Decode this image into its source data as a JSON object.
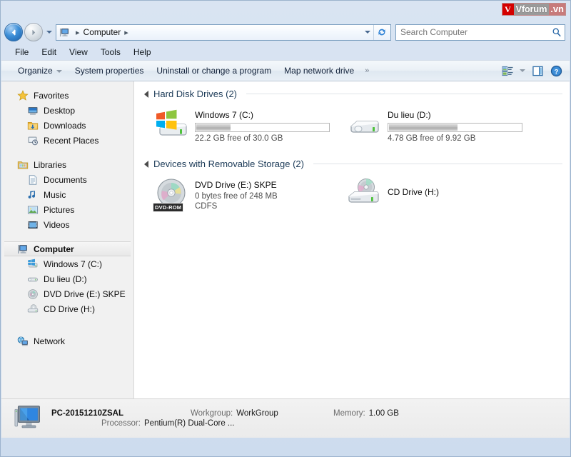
{
  "watermark": {
    "v": "V",
    "name": "Vforum",
    "tld": ".vn"
  },
  "nav": {
    "back_icon": "arrow-left-icon",
    "forward_icon": "arrow-right-icon",
    "recent_dropdown_icon": "chevron-down-icon",
    "address": {
      "computer_icon": "computer-icon",
      "crumb": "Computer",
      "sep1": "▸",
      "sep2": "▸",
      "dropdown_icon": "chevron-down-icon",
      "refresh_icon": "refresh-icon",
      "refresh_glyph": "↻"
    },
    "search": {
      "placeholder": "Search Computer",
      "value": "",
      "icon": "search-icon"
    }
  },
  "menubar": {
    "items": [
      "File",
      "Edit",
      "View",
      "Tools",
      "Help"
    ]
  },
  "toolbar": {
    "organize": "Organize",
    "system_properties": "System properties",
    "uninstall": "Uninstall or change a program",
    "map_network_drive": "Map network drive",
    "overflow": "»",
    "view_icon": "view-layout-icon",
    "preview_icon": "preview-pane-icon",
    "help_icon": "help-icon",
    "help_glyph": "?"
  },
  "sidebar": {
    "groups": [
      {
        "header": {
          "label": "Favorites",
          "icon": "star-icon"
        },
        "items": [
          {
            "label": "Desktop",
            "icon": "desktop-icon"
          },
          {
            "label": "Downloads",
            "icon": "downloads-folder-icon"
          },
          {
            "label": "Recent Places",
            "icon": "recent-places-icon"
          }
        ]
      },
      {
        "header": {
          "label": "Libraries",
          "icon": "libraries-icon"
        },
        "items": [
          {
            "label": "Documents",
            "icon": "documents-icon"
          },
          {
            "label": "Music",
            "icon": "music-note-icon"
          },
          {
            "label": "Pictures",
            "icon": "pictures-icon"
          },
          {
            "label": "Videos",
            "icon": "videos-icon"
          }
        ]
      },
      {
        "header": {
          "label": "Computer",
          "icon": "computer-icon",
          "selected": true
        },
        "items": [
          {
            "label": "Windows 7 (C:)",
            "icon": "windows-drive-icon"
          },
          {
            "label": "Du lieu (D:)",
            "icon": "hard-drive-icon"
          },
          {
            "label": "DVD Drive (E:) SKPE",
            "icon": "dvd-disc-icon"
          },
          {
            "label": "CD Drive (H:)",
            "icon": "cd-drive-icon"
          }
        ]
      },
      {
        "header": {
          "label": "Network",
          "icon": "network-icon"
        },
        "items": []
      }
    ]
  },
  "content": {
    "groups": [
      {
        "title": "Hard Disk Drives (2)",
        "collapse_icon": "triangle-expanded-icon",
        "items": [
          {
            "name": "Windows 7 (C:)",
            "icon": "windows-drive-icon",
            "free_text": "22.2 GB free of 30.0 GB",
            "used_percent": 26,
            "extra": ""
          },
          {
            "name": "Du lieu (D:)",
            "icon": "hard-drive-icon",
            "free_text": "4.78 GB free of 9.92 GB",
            "used_percent": 52,
            "extra": ""
          }
        ]
      },
      {
        "title": "Devices with Removable Storage (2)",
        "collapse_icon": "triangle-expanded-icon",
        "items": [
          {
            "name": "DVD Drive (E:) SKPE",
            "icon": "dvd-disc-icon",
            "badge": "DVD-ROM",
            "free_text": "0 bytes free of 248 MB",
            "used_percent": null,
            "extra": "CDFS"
          },
          {
            "name": "CD Drive (H:)",
            "icon": "cd-drive-icon",
            "free_text": "",
            "used_percent": null,
            "extra": ""
          }
        ]
      }
    ]
  },
  "details": {
    "icon": "computer-monitor-icon",
    "computer_name": "PC-20151210ZSAL",
    "workgroup_label": "Workgroup:",
    "workgroup_value": "WorkGroup",
    "memory_label": "Memory:",
    "memory_value": "1.00 GB",
    "processor_label": "Processor:",
    "processor_value": "Pentium(R) Dual-Core  ..."
  },
  "colors": {
    "frame": "#cddcee",
    "accent_blue": "#1b5fa8",
    "group_title": "#1b3a57",
    "pane_bg": "#f1f1f1",
    "content_bg": "#ffffff",
    "watermark_red": "#d40000"
  }
}
